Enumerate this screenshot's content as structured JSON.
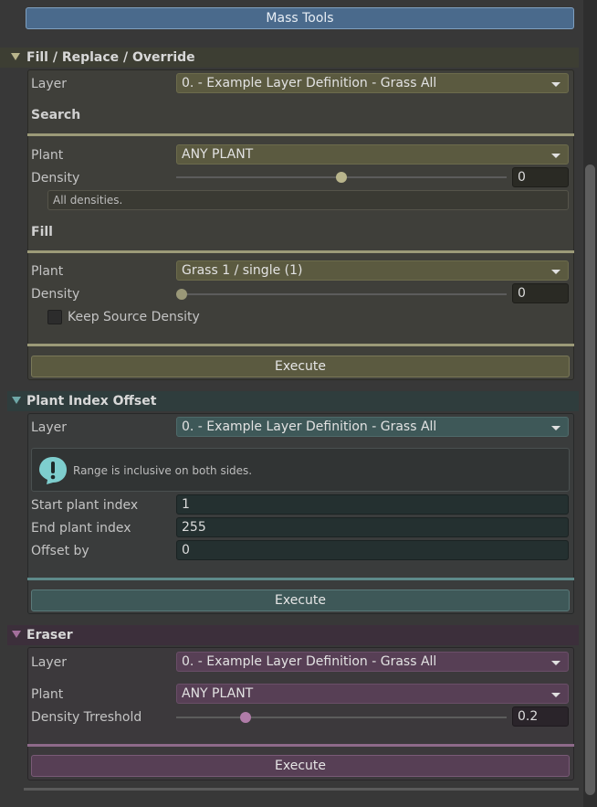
{
  "top_button": "Mass Tools",
  "fill_section": {
    "title": "Fill / Replace / Override",
    "layer_label": "Layer",
    "layer_value": "0. - Example Layer Definition - Grass All",
    "search_heading": "Search",
    "search_plant_label": "Plant",
    "search_plant_value": "ANY PLANT",
    "search_density_label": "Density",
    "search_density_value": "0",
    "search_density_fraction": 0.5,
    "search_help": "All densities.",
    "fill_heading": "Fill",
    "fill_plant_label": "Plant",
    "fill_plant_value": "Grass 1 / single (1)",
    "fill_density_label": "Density",
    "fill_density_value": "0",
    "fill_density_fraction": 0.0,
    "keep_source_label": "Keep Source Density",
    "execute_label": "Execute"
  },
  "offset_section": {
    "title": "Plant Index Offset",
    "layer_label": "Layer",
    "layer_value": "0. - Example Layer Definition - Grass All",
    "info_text": "Range is inclusive on both sides.",
    "info_icon": "exclamation-icon",
    "start_label": "Start plant index",
    "start_value": "1",
    "end_label": "End plant index",
    "end_value": "255",
    "offset_label": "Offset by",
    "offset_value": "0",
    "execute_label": "Execute"
  },
  "eraser_section": {
    "title": "Eraser",
    "layer_label": "Layer",
    "layer_value": "0. - Example Layer Definition - Grass All",
    "plant_label": "Plant",
    "plant_value": "ANY PLANT",
    "threshold_label": "Density Trreshold",
    "threshold_value": "0.2",
    "threshold_fraction": 0.2,
    "execute_label": "Execute"
  },
  "colors": {
    "fill_accent": "#c8c49a",
    "offset_accent": "#6fa8a8",
    "eraser_accent": "#a46f9c"
  }
}
